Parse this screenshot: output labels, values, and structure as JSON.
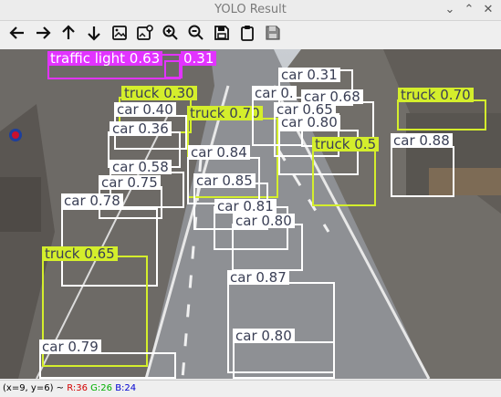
{
  "window": {
    "title": "YOLO Result"
  },
  "toolbar": {
    "buttons": [
      {
        "name": "left-arrow-button",
        "icon": "arrow-left-icon"
      },
      {
        "name": "right-arrow-button",
        "icon": "arrow-right-icon"
      },
      {
        "name": "up-arrow-button",
        "icon": "arrow-up-icon"
      },
      {
        "name": "down-arrow-button",
        "icon": "arrow-down-icon"
      },
      {
        "name": "image-button",
        "icon": "image-icon"
      },
      {
        "name": "image-settings-button",
        "icon": "image-gear-icon"
      },
      {
        "name": "zoom-in-button",
        "icon": "zoom-in-icon"
      },
      {
        "name": "zoom-out-button",
        "icon": "zoom-out-icon"
      },
      {
        "name": "save-button",
        "icon": "floppy-icon"
      },
      {
        "name": "clipboard-button",
        "icon": "clipboard-icon"
      },
      {
        "name": "save-as-button",
        "icon": "floppy-disabled-icon"
      }
    ]
  },
  "detections": [
    {
      "label": "traffic light 0.63",
      "color": "#e233ff"
    },
    {
      "label": "0.31",
      "color": "#e233ff"
    },
    {
      "label": "car 0.31",
      "color": "#ffffff"
    },
    {
      "label": "truck 0.30",
      "color": "#d4ee2c"
    },
    {
      "label": "car 0.40",
      "color": "#ffffff"
    },
    {
      "label": "car 0.36",
      "color": "#ffffff"
    },
    {
      "label": "truck 0.70",
      "color": "#d4ee2c"
    },
    {
      "label": "car 0.",
      "color": "#ffffff"
    },
    {
      "label": "car 0.68",
      "color": "#ffffff"
    },
    {
      "label": "car 0.65",
      "color": "#ffffff"
    },
    {
      "label": "car 0.80",
      "color": "#ffffff"
    },
    {
      "label": "truck 0.70",
      "color": "#d4ee2c"
    },
    {
      "label": "truck 0.5",
      "color": "#d4ee2c"
    },
    {
      "label": "car 0.88",
      "color": "#ffffff"
    },
    {
      "label": "car 0.84",
      "color": "#ffffff"
    },
    {
      "label": "car 0.58",
      "color": "#ffffff"
    },
    {
      "label": "car 0.75",
      "color": "#ffffff"
    },
    {
      "label": "car 0.85",
      "color": "#ffffff"
    },
    {
      "label": "car 0.78",
      "color": "#ffffff"
    },
    {
      "label": "car 0.81",
      "color": "#ffffff"
    },
    {
      "label": "car 0.80",
      "color": "#ffffff"
    },
    {
      "label": "truck 0.65",
      "color": "#d4ee2c"
    },
    {
      "label": "car 0.87",
      "color": "#ffffff"
    },
    {
      "label": "car 0.80",
      "color": "#ffffff"
    },
    {
      "label": "car 0.79",
      "color": "#ffffff"
    }
  ],
  "status": {
    "coords": "(x=9, y=6) ~",
    "r": "R:36",
    "g": "G:26",
    "b": "B:24",
    "r_color": "#d40000",
    "g_color": "#00b000",
    "b_color": "#0000d0"
  }
}
